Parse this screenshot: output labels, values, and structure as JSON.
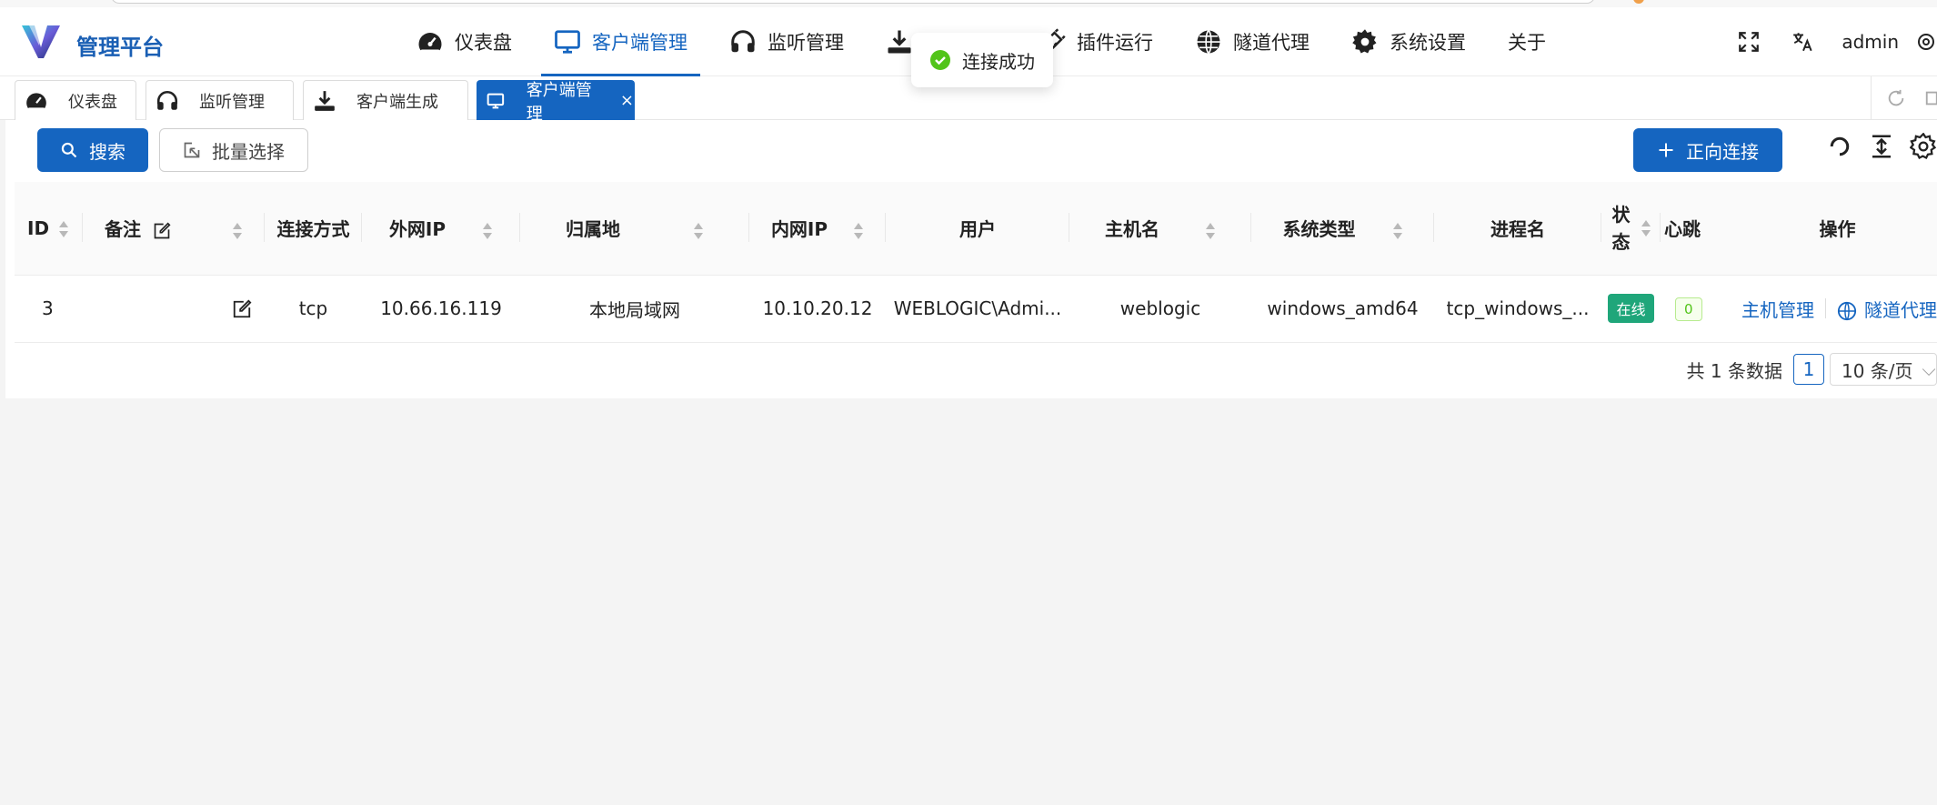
{
  "brand": {
    "name": "管理平台",
    "accent": "#1565c0"
  },
  "nav": [
    {
      "label": "仪表盘",
      "icon": "dashboard-icon"
    },
    {
      "label": "客户端管理",
      "icon": "monitor-icon"
    },
    {
      "label": "监听管理",
      "icon": "headphones-icon"
    },
    {
      "label": "",
      "icon": "download-icon"
    },
    {
      "label": "插件运行",
      "icon": "plug-icon"
    },
    {
      "label": "隧道代理",
      "icon": "globe-icon"
    },
    {
      "label": "系统设置",
      "icon": "gear-icon"
    },
    {
      "label": "关于",
      "icon": ""
    }
  ],
  "topRight": {
    "user": "admin"
  },
  "tabs": [
    {
      "label": "仪表盘",
      "icon": "dashboard-icon"
    },
    {
      "label": "监听管理",
      "icon": "headphones-icon"
    },
    {
      "label": "客户端生成",
      "icon": "download-icon"
    },
    {
      "label": "客户端管理",
      "icon": "monitor-icon",
      "close": "×"
    }
  ],
  "toolbar": {
    "search": "搜索",
    "batch": "批量选择",
    "connect": "正向连接"
  },
  "table": {
    "headers": [
      "ID",
      "备注",
      "连接方式",
      "外网IP",
      "归属地",
      "内网IP",
      "用户",
      "主机名",
      "系统类型",
      "进程名",
      "状态",
      "心跳",
      "操作"
    ],
    "rows": [
      {
        "id": "3",
        "note": "",
        "conn": "tcp",
        "wanIp": "10.66.16.119",
        "location": "本地局域网",
        "lanIp": "10.10.20.12",
        "user": "WEBLOGIC\\Admi...",
        "host": "weblogic",
        "os": "windows_amd64",
        "proc": "tcp_windows_...",
        "status": "在线",
        "beat": "0",
        "op1": "主机管理",
        "op2": "隧道代理"
      }
    ]
  },
  "pager": {
    "total": "共 1 条数据",
    "page": "1",
    "size": "10 条/页"
  },
  "toast": {
    "message": "连接成功"
  }
}
